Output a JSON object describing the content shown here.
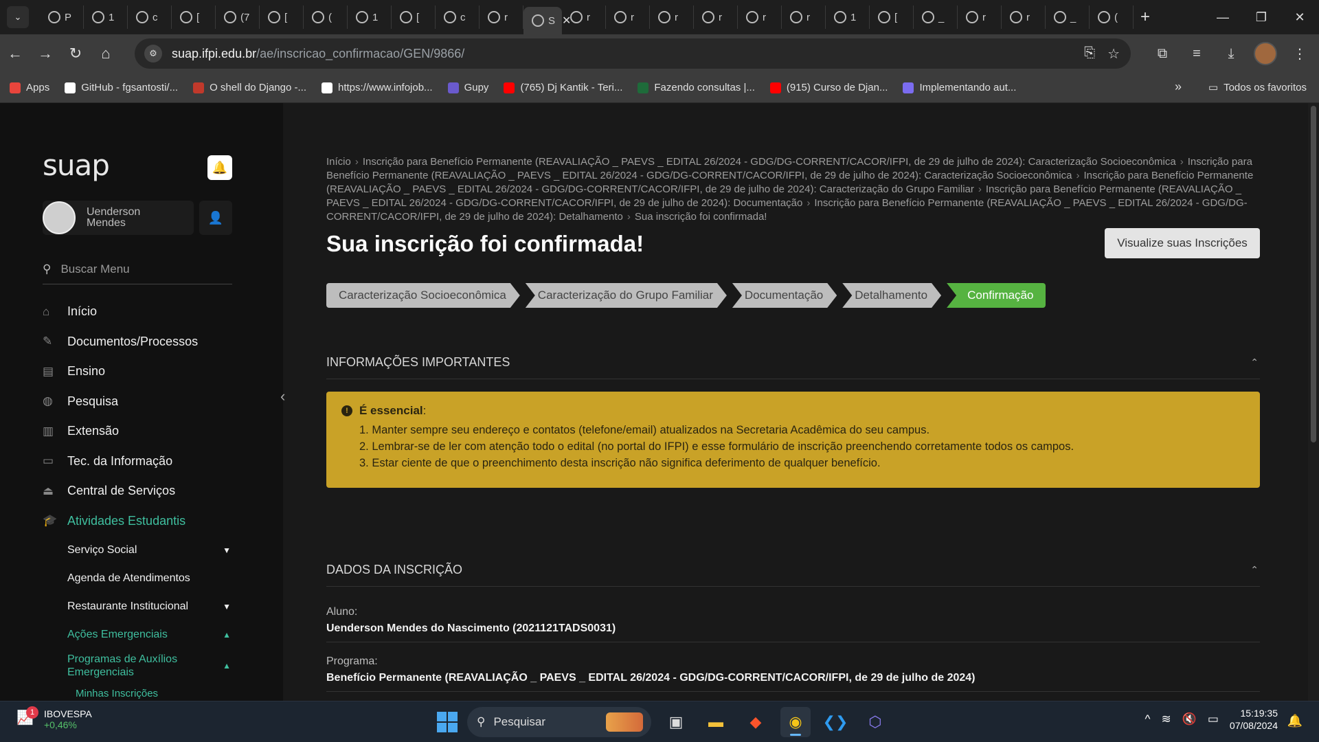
{
  "browser": {
    "tabs": [
      {
        "label": "P",
        "icon": "app-icon"
      },
      {
        "label": "1",
        "icon": "globe-icon"
      },
      {
        "label": "c",
        "icon": "globe-icon"
      },
      {
        "label": "[",
        "icon": "globe-icon"
      },
      {
        "label": "(7",
        "icon": "speaker-icon"
      },
      {
        "label": "[",
        "icon": "globe-icon"
      },
      {
        "label": "(",
        "icon": "whatsapp-icon"
      },
      {
        "label": "1",
        "icon": "globe-icon"
      },
      {
        "label": "[",
        "icon": "globe-icon"
      },
      {
        "label": "c",
        "icon": "globe-icon"
      },
      {
        "label": "r",
        "icon": "globe-icon"
      }
    ],
    "active_tab": {
      "label": "S",
      "close": "✕"
    },
    "tabs_after": [
      {
        "label": "r"
      },
      {
        "label": "r"
      },
      {
        "label": "r"
      },
      {
        "label": "r"
      },
      {
        "label": "r"
      },
      {
        "label": "r"
      },
      {
        "label": "1"
      },
      {
        "label": "["
      },
      {
        "label": "_"
      },
      {
        "label": "r"
      },
      {
        "label": "r"
      },
      {
        "label": "_"
      },
      {
        "label": "("
      }
    ],
    "url_domain": "suap.ifpi.edu.br",
    "url_path": "/ae/inscricao_confirmacao/GEN/9866/",
    "bookmarks": [
      {
        "label": "Apps",
        "color": "#e8453c"
      },
      {
        "label": "GitHub - fgsantosti/...",
        "color": "#ffffff"
      },
      {
        "label": "O shell do Django -...",
        "color": "#c0392b"
      },
      {
        "label": "https://www.infojob...",
        "color": "#ffffff"
      },
      {
        "label": "Gupy",
        "color": "#6a5acd"
      },
      {
        "label": "(765) Dj Kantik - Teri...",
        "color": "#ff0000"
      },
      {
        "label": "Fazendo consultas |...",
        "color": "#1e6b3a"
      },
      {
        "label": "(915) Curso de Djan...",
        "color": "#ff0000"
      },
      {
        "label": "Implementando aut...",
        "color": "#7b6cf0"
      }
    ],
    "bookmarks_all": "Todos os favoritos"
  },
  "sidebar": {
    "logo": "suap",
    "user": {
      "first": "Uenderson",
      "last": "Mendes"
    },
    "search_placeholder": "Buscar Menu",
    "menu": [
      {
        "label": "Início",
        "icon": "home-icon"
      },
      {
        "label": "Documentos/Processos",
        "icon": "document-icon"
      },
      {
        "label": "Ensino",
        "icon": "teaching-icon"
      },
      {
        "label": "Pesquisa",
        "icon": "globe-icon"
      },
      {
        "label": "Extensão",
        "icon": "building-icon"
      },
      {
        "label": "Tec. da Informação",
        "icon": "laptop-icon"
      },
      {
        "label": "Central de Serviços",
        "icon": "bell-service-icon"
      },
      {
        "label": "Atividades Estudantis",
        "icon": "graduation-icon"
      }
    ],
    "submenu": [
      {
        "label": "Serviço Social",
        "chevron": "down"
      },
      {
        "label": "Agenda de Atendimentos",
        "chevron": ""
      },
      {
        "label": "Restaurante Institucional",
        "chevron": "down"
      },
      {
        "label": "Ações Emergenciais",
        "chevron": "up"
      },
      {
        "label": "Programas de Auxílios Emergenciais",
        "chevron": "up"
      }
    ],
    "subsub": "Minhas Inscrições"
  },
  "main": {
    "breadcrumb": [
      "Início",
      "Inscrição para Benefício Permanente (REAVALIAÇÃO _ PAEVS _ EDITAL 26/2024 - GDG/DG-CORRENT/CACOR/IFPI, de 29 de julho de 2024): Caracterização Socioeconômica",
      "Inscrição para Benefício Permanente (REAVALIAÇÃO _ PAEVS _ EDITAL 26/2024 - GDG/DG-CORRENT/CACOR/IFPI, de 29 de julho de 2024): Caracterização Socioeconômica",
      "Inscrição para Benefício Permanente (REAVALIAÇÃO _ PAEVS _ EDITAL 26/2024 - GDG/DG-CORRENT/CACOR/IFPI, de 29 de julho de 2024): Caracterização do Grupo Familiar",
      "Inscrição para Benefício Permanente (REAVALIAÇÃO _ PAEVS _ EDITAL 26/2024 - GDG/DG-CORRENT/CACOR/IFPI, de 29 de julho de 2024): Documentação",
      "Inscrição para Benefício Permanente (REAVALIAÇÃO _ PAEVS _ EDITAL 26/2024 - GDG/DG-CORRENT/CACOR/IFPI, de 29 de julho de 2024): Detalhamento",
      "Sua inscrição foi confirmada!"
    ],
    "title": "Sua inscrição foi confirmada!",
    "view_button": "Visualize suas Inscrições",
    "steps": [
      "Caracterização Socioeconômica",
      "Caracterização do Grupo Familiar",
      "Documentação",
      "Detalhamento",
      "Confirmação"
    ],
    "section_info": "INFORMAÇÕES IMPORTANTES",
    "alert": {
      "title": "É essencial",
      "items": [
        "1. Manter sempre seu endereço e contatos (telefone/email) atualizados na Secretaria Acadêmica do seu campus.",
        "2. Lembrar-se de ler com atenção todo o edital (no portal do IFPI) e esse formulário de inscrição preenchendo corretamente todos os campos.",
        "3. Estar ciente de que o preenchimento desta inscrição não significa deferimento de qualquer benefício."
      ]
    },
    "section_data": "DADOS DA INSCRIÇÃO",
    "aluno_label": "Aluno:",
    "aluno_value": "Uenderson Mendes do Nascimento (2021121TADS0031)",
    "programa_label": "Programa:",
    "programa_value": "Benefício Permanente (REAVALIAÇÃO _ PAEVS _ EDITAL 26/2024 - GDG/DG-CORRENT/CACOR/IFPI, de 29 de julho de 2024)"
  },
  "taskbar": {
    "stock_name": "IBOVESPA",
    "stock_change": "+0,46%",
    "stock_badge": "1",
    "search_label": "Pesquisar",
    "time": "15:19:35",
    "date": "07/08/2024"
  },
  "colors": {
    "accent": "#3fbf9f",
    "step_done": "#56b341",
    "alert_bg": "#c9a227"
  }
}
